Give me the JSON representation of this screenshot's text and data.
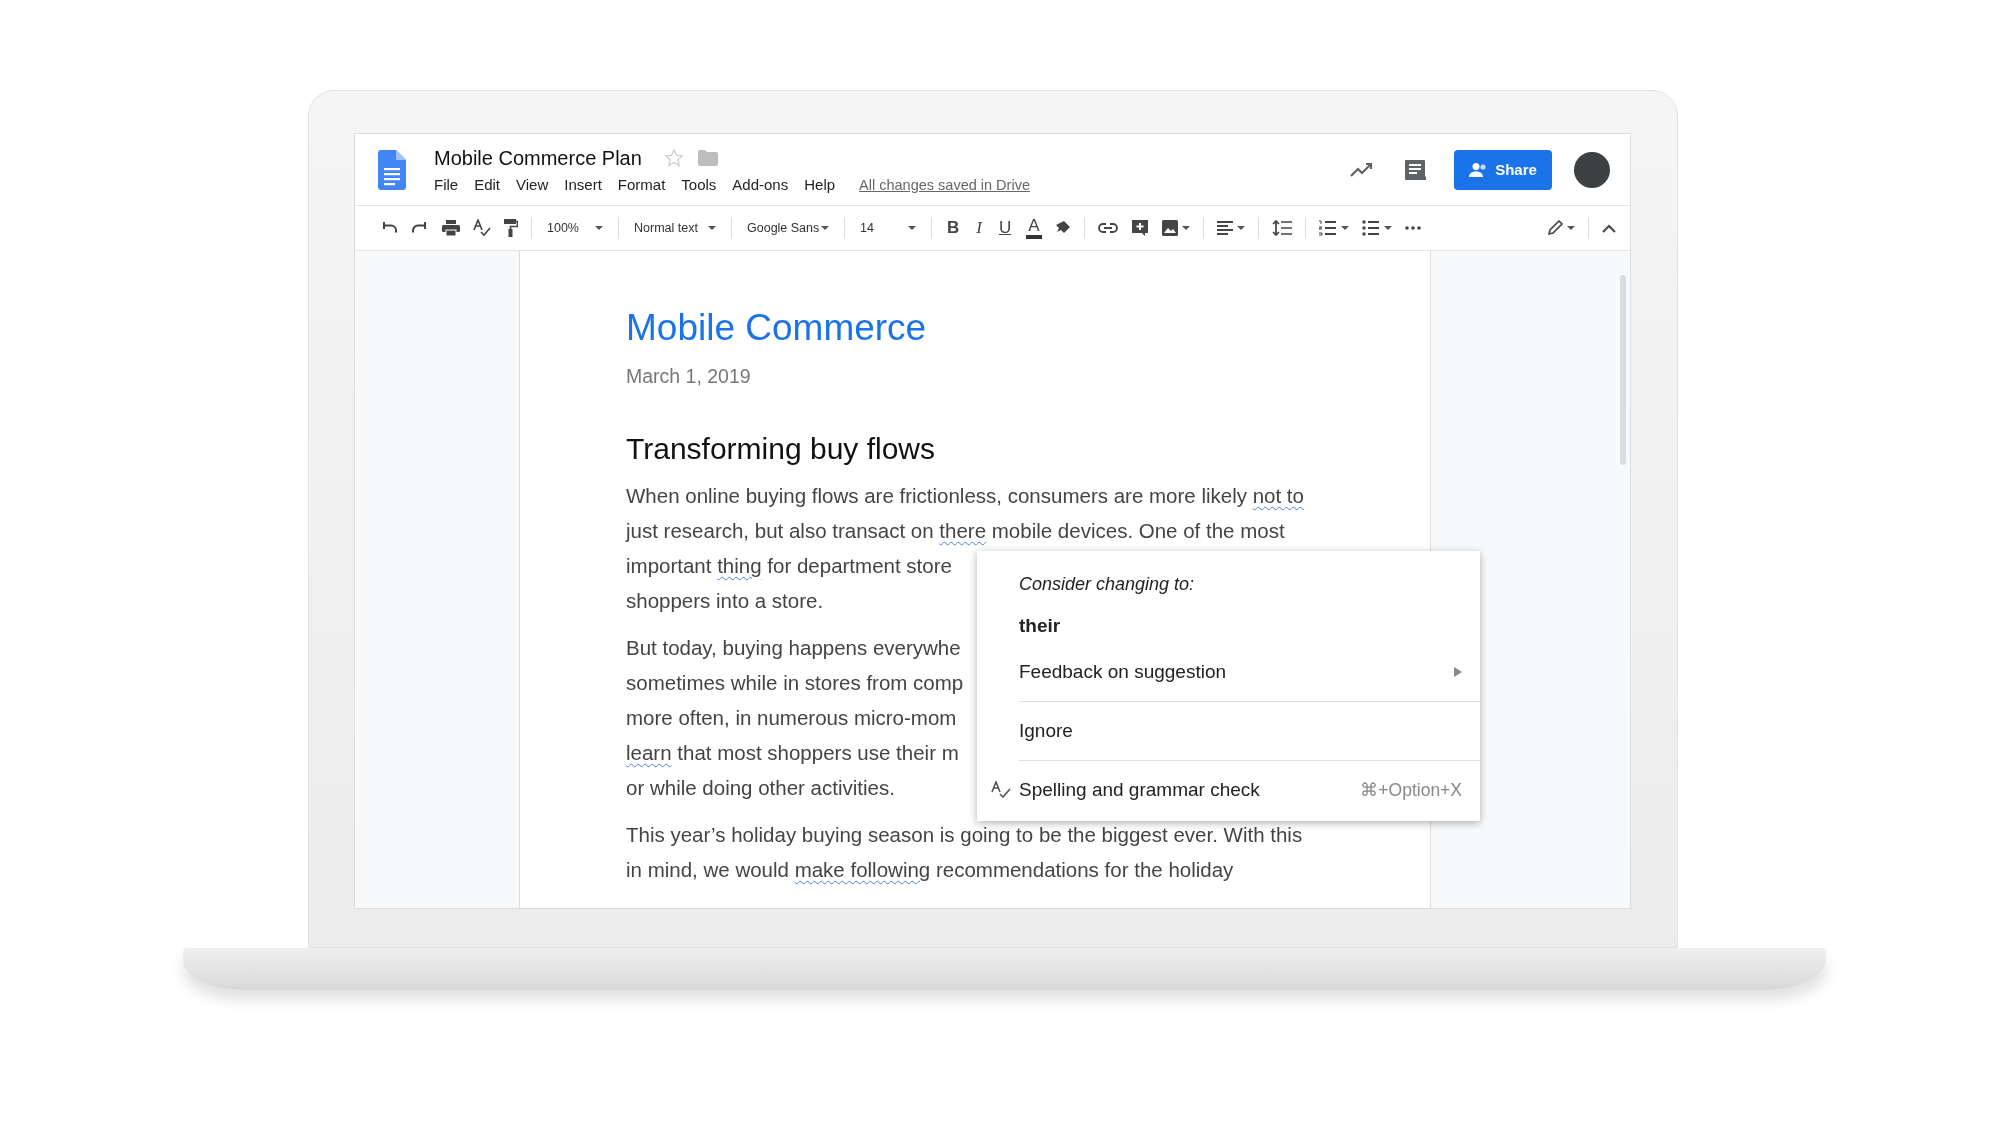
{
  "document_title": "Mobile Commerce Plan",
  "starred": false,
  "menu": [
    "File",
    "Edit",
    "View",
    "Insert",
    "Format",
    "Tools",
    "Add-ons",
    "Help"
  ],
  "save_status": "All changes saved in Drive",
  "share_button": "Share",
  "toolbar": {
    "zoom": "100%",
    "style": "Normal text",
    "font": "Google Sans",
    "size": "14",
    "format_buttons": [
      {
        "label": "B",
        "kind": "bold"
      },
      {
        "label": "I",
        "kind": "italic"
      },
      {
        "label": "U",
        "kind": "underline"
      },
      {
        "label": "A",
        "kind": "text_color"
      }
    ]
  },
  "document": {
    "title": "Mobile Commerce",
    "date": "March 1, 2019",
    "heading": "Transforming buy flows",
    "paragraphs": [
      {
        "lines": [
          [
            {
              "text": "When online buying flows are frictionless, consumers are more likely ",
              "flagged": false
            },
            {
              "text": "not to",
              "flagged": true
            }
          ],
          [
            {
              "text": "just research, but also transact on ",
              "flagged": false
            },
            {
              "text": "there",
              "flagged": true
            },
            {
              "text": " mobile devices. One of the most",
              "flagged": false
            }
          ],
          [
            {
              "text": "important ",
              "flagged": false
            },
            {
              "text": "thing",
              "flagged": true
            },
            {
              "text": " for department store",
              "flagged": false
            }
          ],
          [
            {
              "text": "shoppers into a store.",
              "flagged": false
            }
          ]
        ]
      },
      {
        "lines": [
          [
            {
              "text": "But today, buying happens everywhe",
              "flagged": false
            }
          ],
          [
            {
              "text": "sometimes while in stores from comp",
              "flagged": false
            }
          ],
          [
            {
              "text": "more often, in numerous micro-mom",
              "flagged": false
            }
          ],
          [
            {
              "text": "learn",
              "flagged": true
            },
            {
              "text": " that most shoppers use their m",
              "flagged": false
            }
          ],
          [
            {
              "text": "or while doing other activities.",
              "flagged": false
            }
          ]
        ]
      },
      {
        "lines": [
          [
            {
              "text": "This year’s holiday buying season is going to be the biggest ever. With this",
              "flagged": false
            }
          ],
          [
            {
              "text": "in mind, we would ",
              "flagged": false
            },
            {
              "text": "make following",
              "flagged": true
            },
            {
              "text": " recommendations for the holiday",
              "flagged": false
            }
          ]
        ]
      }
    ]
  },
  "suggestion_menu": {
    "header": "Consider changing to:",
    "suggestion": "their",
    "items": [
      {
        "label": "Feedback on suggestion",
        "kind": "submenu"
      },
      {
        "label": "Ignore",
        "kind": "plain"
      },
      {
        "label": "Spelling and grammar check",
        "kind": "command",
        "shortcut": "⌘+Option+X"
      }
    ]
  }
}
